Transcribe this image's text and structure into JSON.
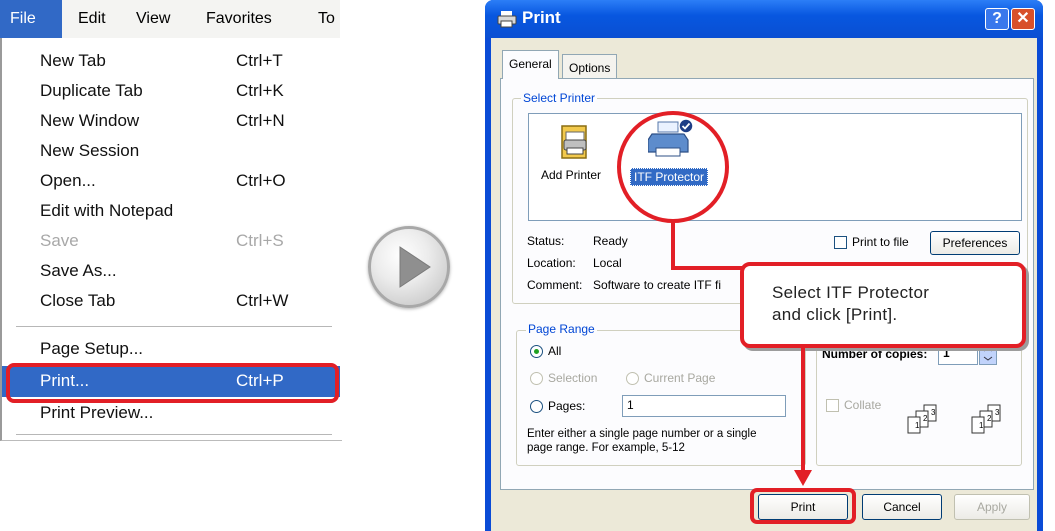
{
  "menubar": {
    "items": [
      "File",
      "Edit",
      "View",
      "Favorites",
      "To"
    ]
  },
  "file_menu": {
    "items": [
      {
        "label": "New Tab",
        "shortcut": "Ctrl+T"
      },
      {
        "label": "Duplicate Tab",
        "shortcut": "Ctrl+K"
      },
      {
        "label": "New Window",
        "shortcut": "Ctrl+N"
      },
      {
        "label": "New Session",
        "shortcut": ""
      },
      {
        "label": "Open...",
        "shortcut": "Ctrl+O"
      },
      {
        "label": "Edit with Notepad",
        "shortcut": ""
      },
      {
        "label": "Save",
        "shortcut": "Ctrl+S"
      },
      {
        "label": "Save As...",
        "shortcut": ""
      },
      {
        "label": "Close Tab",
        "shortcut": "Ctrl+W"
      },
      {
        "label": "Page Setup...",
        "shortcut": ""
      },
      {
        "label": "Print...",
        "shortcut": "Ctrl+P"
      },
      {
        "label": "Print Preview...",
        "shortcut": ""
      }
    ]
  },
  "dialog": {
    "title": "Print",
    "tabs": [
      "General",
      "Options"
    ],
    "select_printer": {
      "title": "Select Printer",
      "printers": [
        "Add Printer",
        "ITF Protector"
      ],
      "status_label": "Status:",
      "status_value": "Ready",
      "location_label": "Location:",
      "location_value": "Local",
      "comment_label": "Comment:",
      "comment_value": "Software to create ITF fi",
      "print_to_file": "Print to file",
      "preferences": "Preferences"
    },
    "page_range": {
      "title": "Page Range",
      "all": "All",
      "selection": "Selection",
      "current_page": "Current Page",
      "pages": "Pages:",
      "pages_value": "1",
      "hint_line1": "Enter either a single page number or a single",
      "hint_line2": "page range.  For example, 5-12"
    },
    "copies": {
      "label": "Number of copies:",
      "value": "1",
      "collate": "Collate",
      "icon_pages": [
        "1",
        "2",
        "3"
      ]
    },
    "buttons": {
      "print": "Print",
      "cancel": "Cancel",
      "apply": "Apply"
    }
  },
  "callout": {
    "line1": "Select ITF Protector",
    "line2": "and click [Print]."
  },
  "colors": {
    "highlight": "#e21f26",
    "menu_selection": "#3169c6",
    "xp_title": "#0a4fd2",
    "dialog_face": "#ece9d8"
  }
}
